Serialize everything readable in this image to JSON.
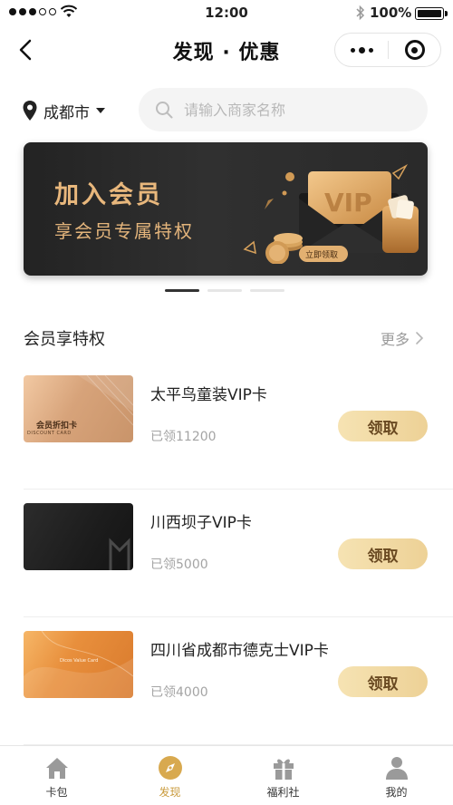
{
  "status_bar": {
    "time": "12:00",
    "battery": "100%"
  },
  "nav": {
    "title": "发现 · 优惠"
  },
  "location": {
    "city": "成都市"
  },
  "search": {
    "placeholder": "请输入商家名称"
  },
  "banner": {
    "title": "加入会员",
    "subtitle": "享会员专属特权",
    "art_vip_text": "VIP",
    "art_button_text": "立即领取",
    "slide_count": 3,
    "active_slide": 1
  },
  "section": {
    "title": "会员享特权",
    "more_label": "更多"
  },
  "cards": [
    {
      "name": "太平鸟童装VIP卡",
      "count": "已领11200",
      "button": "领取",
      "card_style": "gold",
      "card_label_cn": "会员折扣卡",
      "card_label_en": "DISCOUNT CARD"
    },
    {
      "name": "川西坝子VIP卡",
      "count": "已领5000",
      "button": "领取",
      "card_style": "black"
    },
    {
      "name": "四川省成都市德克士VIP卡",
      "count": "已领4000",
      "button": "领取",
      "card_style": "orange",
      "card_label_en": "Dicos Value Card"
    }
  ],
  "tabs": [
    {
      "label": "卡包",
      "icon": "home-icon",
      "active": false
    },
    {
      "label": "发现",
      "icon": "compass-icon",
      "active": true
    },
    {
      "label": "福利社",
      "icon": "gift-icon",
      "active": false
    },
    {
      "label": "我的",
      "icon": "person-icon",
      "active": false
    }
  ],
  "colors": {
    "accent_gold": "#c99a3b",
    "button_gold": "#f0d79f",
    "banner_dark": "#2a2a2a",
    "banner_text": "#e8b77c"
  }
}
